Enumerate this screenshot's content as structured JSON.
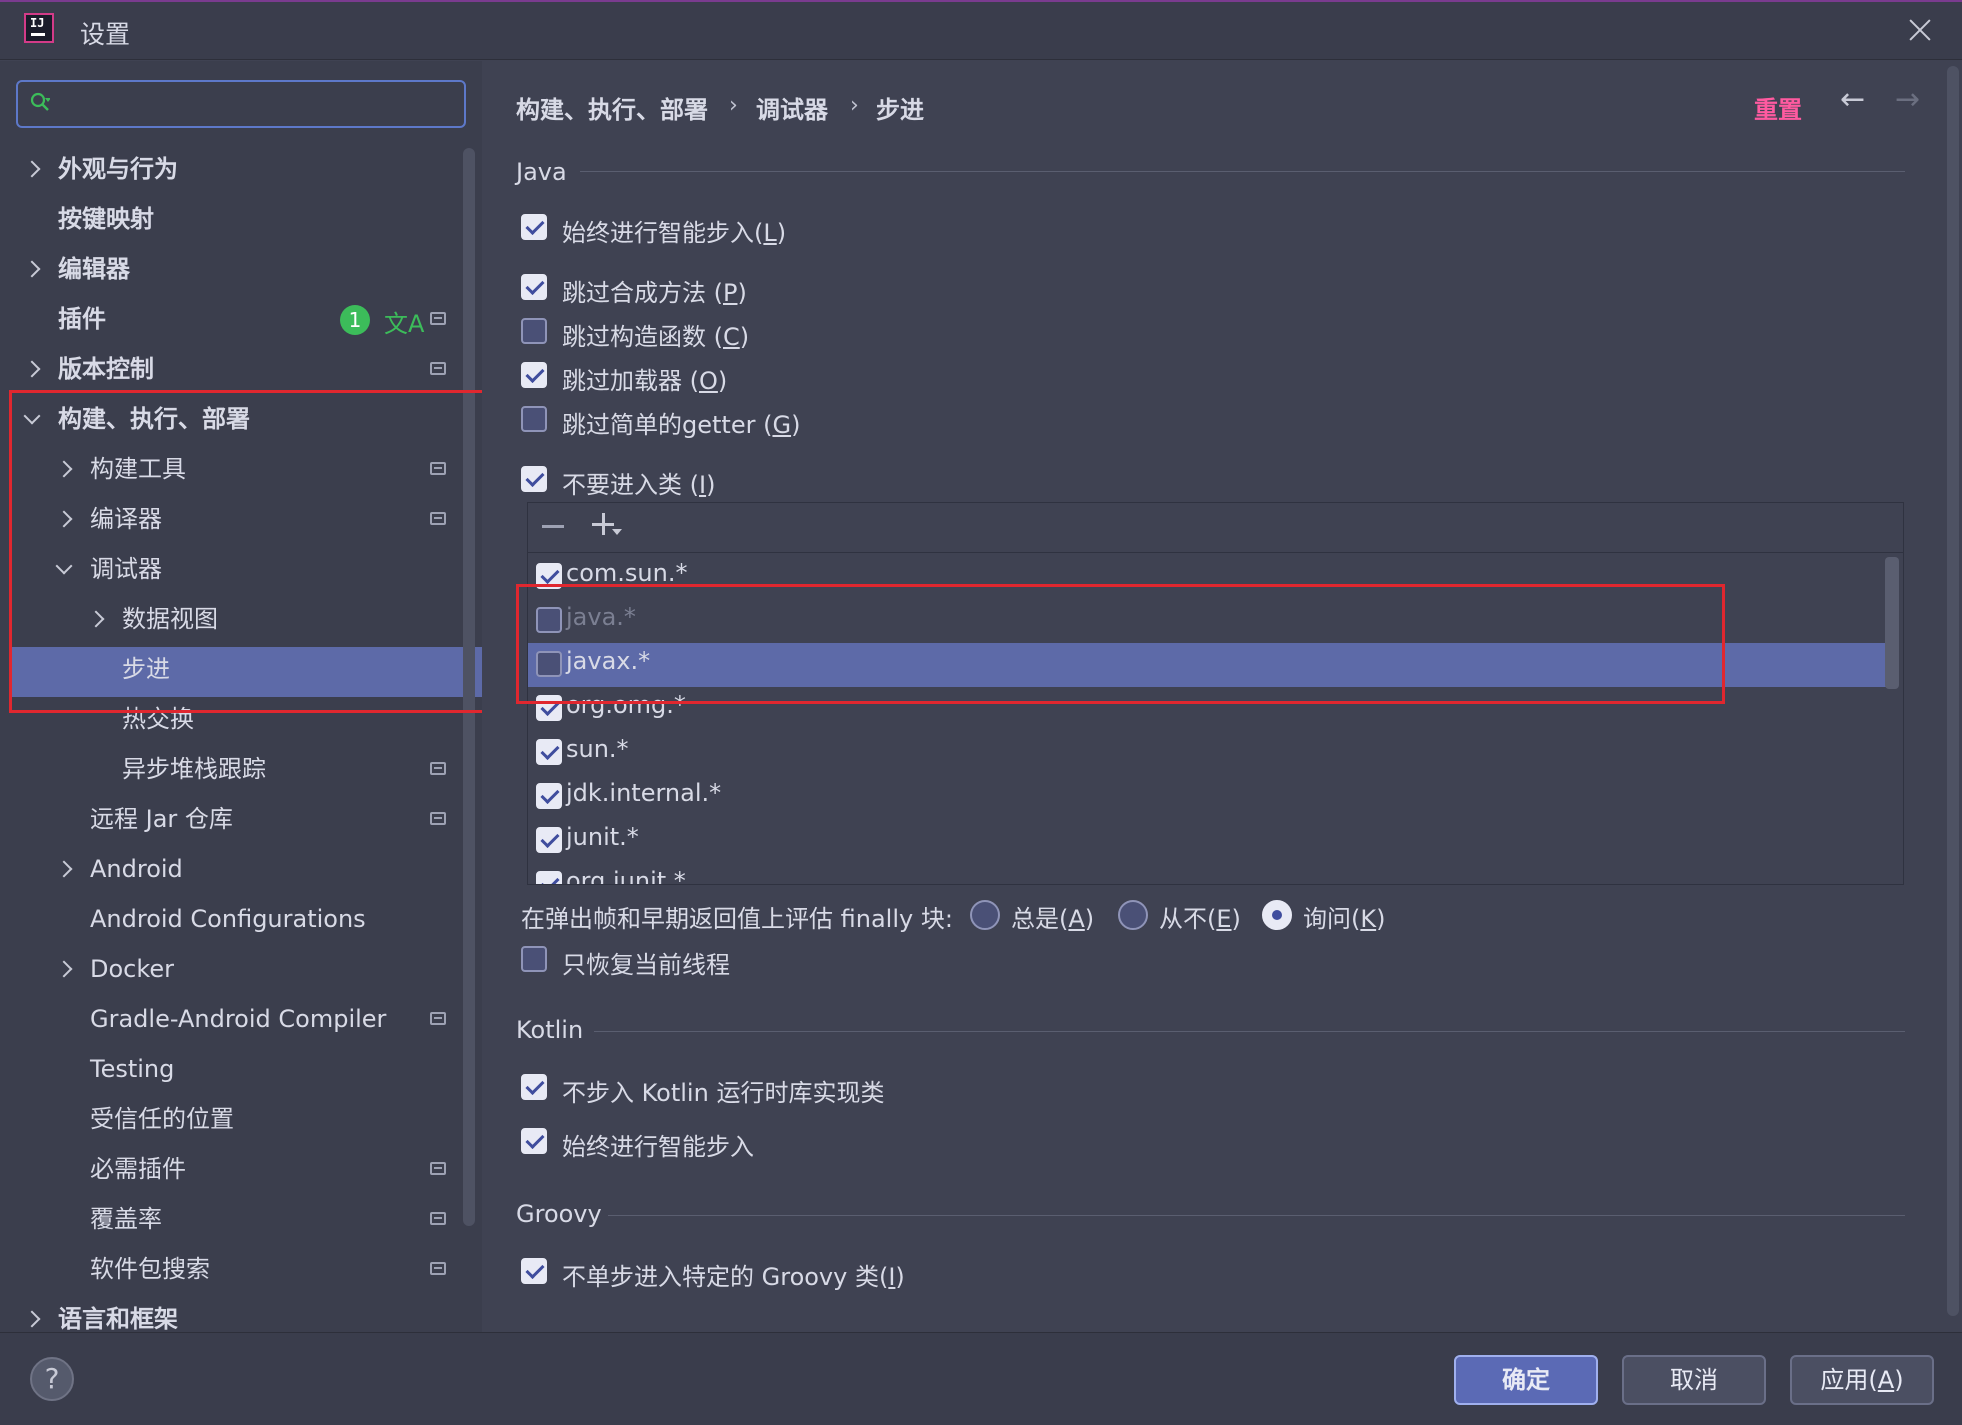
{
  "window": {
    "title": "设置",
    "close_icon": "close-icon",
    "app_icon": "intellij-icon"
  },
  "search": {
    "placeholder": "",
    "value": ""
  },
  "sidebar": {
    "items": [
      {
        "label": "外观与行为",
        "expandable": true,
        "expanded": false,
        "bold": true,
        "depth": 0
      },
      {
        "label": "按键映射",
        "expandable": false,
        "bold": true,
        "depth": 0
      },
      {
        "label": "编辑器",
        "expandable": true,
        "expanded": false,
        "bold": true,
        "depth": 0
      },
      {
        "label": "插件",
        "expandable": false,
        "bold": true,
        "depth": 0,
        "badge": "1"
      },
      {
        "label": "版本控制",
        "expandable": true,
        "expanded": false,
        "bold": true,
        "depth": 0
      },
      {
        "label": "构建、执行、部署",
        "expandable": true,
        "expanded": true,
        "bold": true,
        "depth": 0
      },
      {
        "label": "构建工具",
        "expandable": true,
        "expanded": false,
        "depth": 1
      },
      {
        "label": "编译器",
        "expandable": true,
        "expanded": false,
        "depth": 1
      },
      {
        "label": "调试器",
        "expandable": true,
        "expanded": true,
        "depth": 1
      },
      {
        "label": "数据视图",
        "expandable": true,
        "expanded": false,
        "depth": 2
      },
      {
        "label": "步进",
        "expandable": false,
        "depth": 2,
        "selected": true
      },
      {
        "label": "热交换",
        "expandable": false,
        "depth": 2
      },
      {
        "label": "异步堆栈跟踪",
        "expandable": false,
        "depth": 2
      },
      {
        "label": "远程 Jar 仓库",
        "expandable": false,
        "depth": 1
      },
      {
        "label": "Android",
        "expandable": true,
        "expanded": false,
        "depth": 1
      },
      {
        "label": "Android Configurations",
        "expandable": false,
        "depth": 1
      },
      {
        "label": "Docker",
        "expandable": true,
        "expanded": false,
        "depth": 1
      },
      {
        "label": "Gradle-Android Compiler",
        "expandable": false,
        "depth": 1
      },
      {
        "label": "Testing",
        "expandable": false,
        "depth": 1
      },
      {
        "label": "受信任的位置",
        "expandable": false,
        "depth": 1
      },
      {
        "label": "必需插件",
        "expandable": false,
        "depth": 1
      },
      {
        "label": "覆盖率",
        "expandable": false,
        "depth": 1
      },
      {
        "label": "软件包搜索",
        "expandable": false,
        "depth": 1
      },
      {
        "label": "语言和框架",
        "expandable": true,
        "expanded": false,
        "bold": true,
        "depth": 0
      }
    ]
  },
  "breadcrumb": [
    "构建、执行、部署",
    "调试器",
    "步进"
  ],
  "header": {
    "reset_label": "重置",
    "reset_color": "#ff5aa0"
  },
  "java": {
    "section_title": "Java",
    "smart_step": {
      "label": "始终进行智能步入(",
      "mnemonic": "L",
      "tail": ")",
      "checked": true
    },
    "skip_synthetic": {
      "label": "跳过合成方法 (",
      "mnemonic": "P",
      "tail": ")",
      "checked": true
    },
    "skip_constructors": {
      "label": "跳过构造函数 (",
      "mnemonic": "C",
      "tail": ")",
      "checked": false
    },
    "skip_classloaders": {
      "label": "跳过加载器 (",
      "mnemonic": "O",
      "tail": ")",
      "checked": true
    },
    "skip_getters": {
      "label": "跳过简单的getter (",
      "mnemonic": "G",
      "tail": ")",
      "checked": false
    },
    "do_not_step_into": {
      "label": "不要进入类 (",
      "mnemonic": "I",
      "tail": ")",
      "checked": true
    },
    "packages": [
      {
        "name": "com.sun.*",
        "checked": true,
        "enabled": true
      },
      {
        "name": "java.*",
        "checked": false,
        "enabled": false
      },
      {
        "name": "javax.*",
        "checked": false,
        "enabled": true,
        "selected": true
      },
      {
        "name": "org.omg.*",
        "checked": true,
        "enabled": true
      },
      {
        "name": "sun.*",
        "checked": true,
        "enabled": true
      },
      {
        "name": "jdk.internal.*",
        "checked": true,
        "enabled": true
      },
      {
        "name": "junit.*",
        "checked": true,
        "enabled": true
      },
      {
        "name": "org.junit.*",
        "checked": true,
        "enabled": true
      }
    ],
    "finally_label": "在弹出帧和早期返回值上评估 finally 块:",
    "finally_options": [
      {
        "label": "总是(",
        "mnemonic": "A",
        "tail": ")",
        "selected": false
      },
      {
        "label": "从不(",
        "mnemonic": "E",
        "tail": ")",
        "selected": false
      },
      {
        "label": "询问(",
        "mnemonic": "K",
        "tail": ")",
        "selected": true
      }
    ],
    "resume_current_thread": {
      "label": "只恢复当前线程",
      "checked": false
    }
  },
  "kotlin": {
    "section_title": "Kotlin",
    "no_stdlib": {
      "label": "不步入 Kotlin 运行时库实现类",
      "checked": true
    },
    "smart_step": {
      "label": "始终进行智能步入",
      "checked": true
    }
  },
  "groovy": {
    "section_title": "Groovy",
    "no_step_into": {
      "label": "不单步进入特定的 Groovy 类(",
      "mnemonic": "I",
      "tail": ")",
      "checked": true
    }
  },
  "footer": {
    "help_label": "?",
    "ok_label": "确定",
    "cancel_label": "取消",
    "apply_label": "应用(",
    "apply_mnemonic": "A",
    "apply_tail": ")"
  },
  "colors": {
    "selection": "#5d6aa8",
    "highlight_box": "#e0272f",
    "accent": "#5d78c9"
  }
}
